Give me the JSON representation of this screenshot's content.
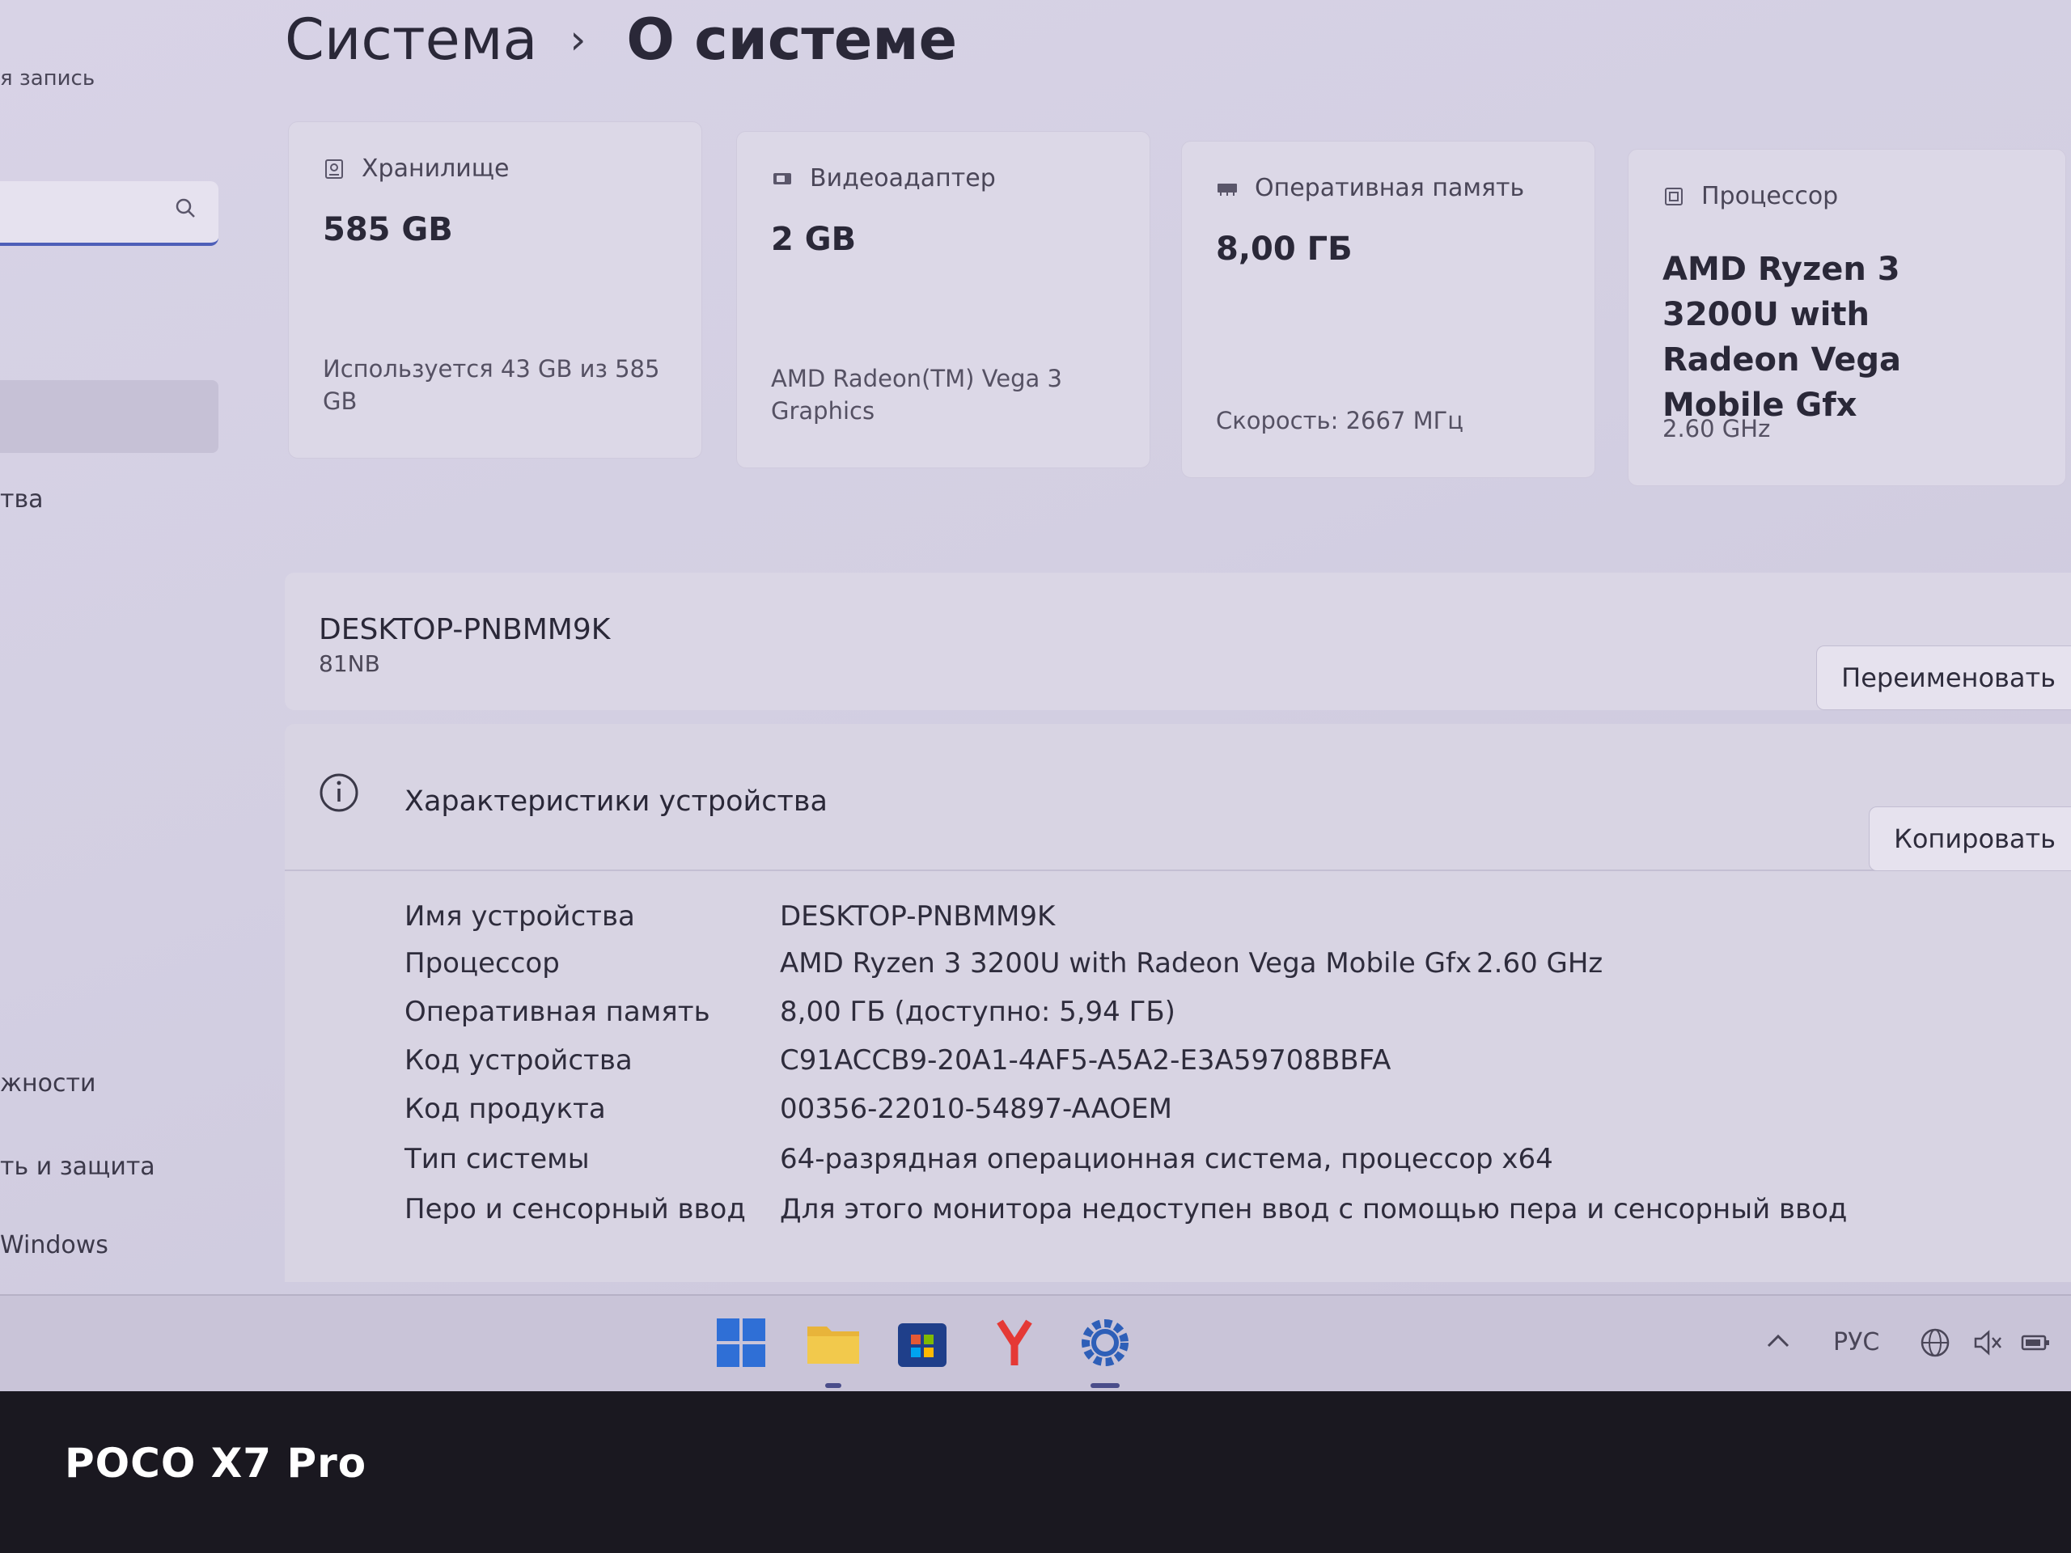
{
  "sidebar": {
    "account_label": "я запись",
    "items": [
      {
        "label": "тва"
      },
      {
        "label": "жности"
      },
      {
        "label": "ть и защита"
      },
      {
        "label": "Windows"
      }
    ]
  },
  "breadcrumb": {
    "parent": "Система",
    "separator": "›",
    "current": "О системе"
  },
  "cards": [
    {
      "label": "Хранилище",
      "value": "585 GB",
      "sub": "Используется 43 GB из 585 GB",
      "icon": "storage-icon"
    },
    {
      "label": "Видеоадаптер",
      "value": "2 GB",
      "sub": "AMD Radeon(TM) Vega 3 Graphics",
      "icon": "gpu-icon"
    },
    {
      "label": "Оперативная память",
      "value": "8,00 ГБ",
      "sub": "Скорость: 2667 МГц",
      "icon": "ram-icon"
    },
    {
      "label": "Процессор",
      "value": "AMD Ryzen 3 3200U with Radeon Vega Mobile Gfx",
      "sub": "2.60 GHz",
      "icon": "cpu-icon"
    }
  ],
  "device": {
    "name": "DESKTOP-PNBMM9K",
    "model": "81NB",
    "rename_label": "Переименовать"
  },
  "specs": {
    "title": "Характеристики устройства",
    "copy_label": "Копировать",
    "rows": [
      {
        "key": "Имя устройства",
        "value": "DESKTOP-PNBMM9K",
        "extra": ""
      },
      {
        "key": "Процессор",
        "value": "AMD Ryzen 3 3200U with Radeon Vega Mobile Gfx",
        "extra": "2.60 GHz"
      },
      {
        "key": "Оперативная память",
        "value": "8,00 ГБ (доступно: 5,94 ГБ)",
        "extra": ""
      },
      {
        "key": "Код устройства",
        "value": "C91ACCB9-20A1-4AF5-A5A2-E3A59708BBFA",
        "extra": ""
      },
      {
        "key": "Код продукта",
        "value": "00356-22010-54897-AAOEM",
        "extra": ""
      },
      {
        "key": "Тип системы",
        "value": "64-разрядная операционная система, процессор x64",
        "extra": ""
      },
      {
        "key": "Перо и сенсорный ввод",
        "value": "Для этого монитора недоступен ввод с помощью пера и сенсорный ввод",
        "extra": ""
      }
    ]
  },
  "taskbar": {
    "apps": [
      "windows-start-icon",
      "file-explorer-icon",
      "store-icon",
      "yandex-browser-icon",
      "settings-icon"
    ],
    "language": "РУС",
    "accent": "#2f6fd6"
  },
  "watermark": "POCO X7 Pro"
}
